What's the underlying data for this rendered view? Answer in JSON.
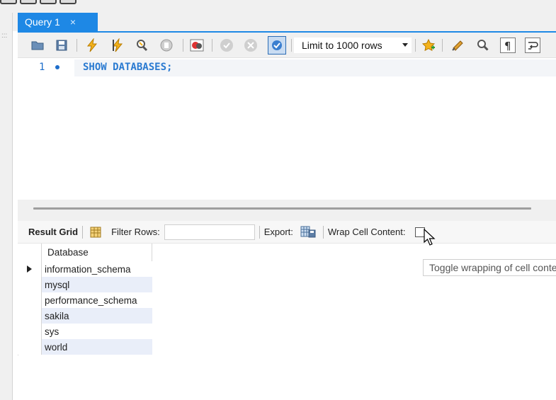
{
  "tabs": [
    {
      "label": "Query 1",
      "close_glyph": "×"
    }
  ],
  "toolbar": {
    "limit_select": {
      "value": "Limit to 1000 rows"
    },
    "icons": [
      "open-folder-icon",
      "save-icon",
      "execute-lightning-icon",
      "execute-cursor-lightning-icon",
      "explain-magnifier-icon",
      "stop-hand-icon",
      "toggle-error-icon",
      "commit-check-icon",
      "rollback-x-icon",
      "autocommit-toggle-icon",
      "add-snippet-star-icon",
      "beautify-brush-icon",
      "find-magnifier-icon",
      "invisible-chars-pilcrow-icon",
      "wrap-lines-icon"
    ]
  },
  "editor": {
    "lines": [
      {
        "number": "1",
        "text": "SHOW DATABASES;"
      }
    ]
  },
  "result_toolbar": {
    "result_grid_label": "Result Grid",
    "filter_rows_label": "Filter Rows:",
    "filter_rows_value": "",
    "export_label": "Export:",
    "wrap_label": "Wrap Cell Content:"
  },
  "grid": {
    "column_header": "Database",
    "rows": [
      "information_schema",
      "mysql",
      "performance_schema",
      "sakila",
      "sys",
      "world"
    ]
  },
  "tooltip": {
    "text": "Toggle wrapping of cell contents"
  },
  "colors": {
    "accent": "#1e88e5",
    "sql_keyword": "#2a7ad1",
    "row_alt": "#e9eef9"
  }
}
